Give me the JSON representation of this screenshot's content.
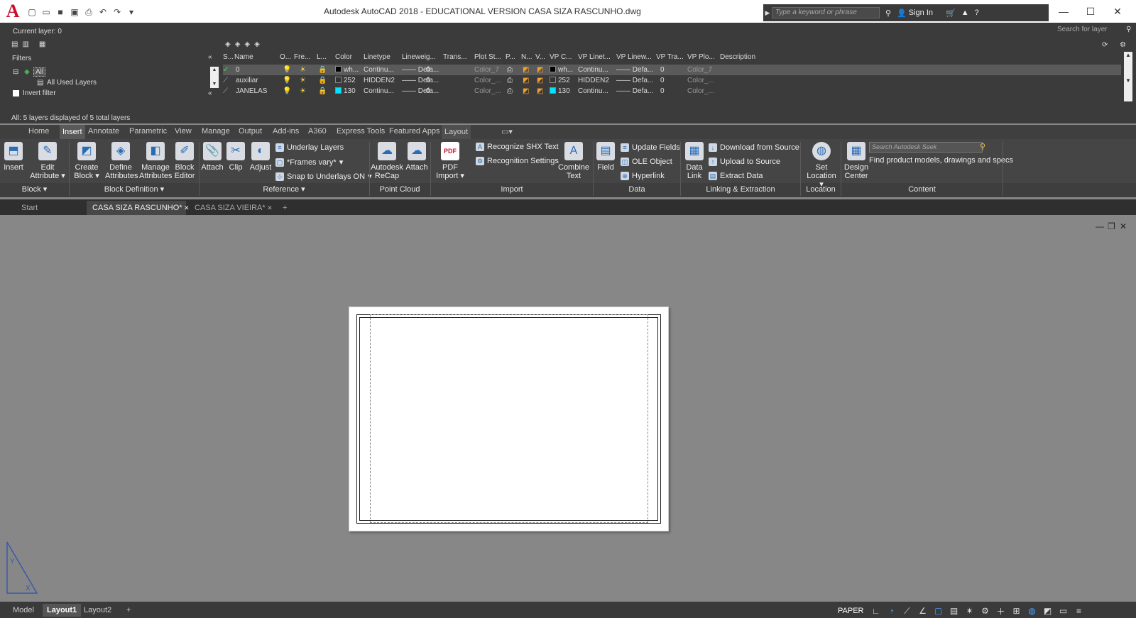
{
  "app": {
    "title": "Autodesk AutoCAD 2018 - EDUCATIONAL VERSION     CASA SIZA RASCUNHO.dwg",
    "logo_letter": "A",
    "search_placeholder": "Type a keyword or phrase",
    "sign_in": "Sign In"
  },
  "layer_panel": {
    "current_layer": "Current layer: 0",
    "search_for_layer": "Search for layer",
    "filters_label": "Filters",
    "tree": [
      "All",
      "All Used Layers"
    ],
    "invert_filter": "Invert filter",
    "status": "All: 5 layers displayed of 5 total layers",
    "columns": [
      "S...",
      "Name",
      "O...",
      "Fre...",
      "L...",
      "Color",
      "Linetype",
      "Lineweig...",
      "Trans...",
      "Plot St...",
      "P...",
      "N...",
      "V...",
      "VP C...",
      "VP Linet...",
      "VP Linew...",
      "VP Tra...",
      "VP Plo...",
      "Description"
    ],
    "rows": [
      {
        "name": "0",
        "color_label": "wh...",
        "color_hex": "#000000",
        "linetype": "Continu...",
        "lineweight": "Defa...",
        "trans": "0",
        "plot_style": "Color_7",
        "vp_color_label": "wh...",
        "vp_color_hex": "#000000",
        "vp_linetype": "Continu...",
        "vp_lineweight": "Defa...",
        "vp_trans": "0",
        "vp_plot": "Color_7"
      },
      {
        "name": "auxiliar",
        "color_label": "252",
        "color_hex": "#333333",
        "linetype": "HIDDEN2",
        "lineweight": "Defa...",
        "trans": "0",
        "plot_style": "Color_...",
        "vp_color_label": "252",
        "vp_color_hex": "#333333",
        "vp_linetype": "HIDDEN2",
        "vp_lineweight": "Defa...",
        "vp_trans": "0",
        "vp_plot": "Color_..."
      },
      {
        "name": "JANELAS",
        "color_label": "130",
        "color_hex": "#00e5ff",
        "linetype": "Continu...",
        "lineweight": "Defa...",
        "trans": "0",
        "plot_style": "Color_...",
        "vp_color_label": "130",
        "vp_color_hex": "#00e5ff",
        "vp_linetype": "Continu...",
        "vp_lineweight": "Defa...",
        "vp_trans": "0",
        "vp_plot": "Color_..."
      }
    ]
  },
  "ribbon": {
    "tabs": [
      "Home",
      "Insert",
      "Annotate",
      "Parametric",
      "View",
      "Manage",
      "Output",
      "Add-ins",
      "A360",
      "Express Tools",
      "Featured Apps",
      "Layout"
    ],
    "active_tab": "Insert",
    "block": {
      "insert": "Insert",
      "edit_attribute": [
        "Edit",
        "Attribute"
      ],
      "footer": "Block"
    },
    "block_definition": {
      "create_block": [
        "Create",
        "Block"
      ],
      "define_attributes": [
        "Define",
        "Attributes"
      ],
      "manage_attributes": [
        "Manage",
        "Attributes"
      ],
      "block_editor": [
        "Block",
        "Editor"
      ],
      "footer": "Block Definition"
    },
    "reference": {
      "attach": "Attach",
      "clip": "Clip",
      "adjust": "Adjust",
      "underlay_layers": "Underlay Layers",
      "frames_vary": "*Frames vary*",
      "snap_to_underlays": "Snap to Underlays ON",
      "footer": "Reference"
    },
    "point_cloud": {
      "recap": [
        "Autodesk",
        "ReCap"
      ],
      "attach": "Attach",
      "footer": "Point Cloud"
    },
    "import": {
      "pdf_import": [
        "PDF",
        "Import"
      ],
      "recognize_shx": "Recognize SHX Text",
      "recognition_settings": "Recognition Settings",
      "combine_text": [
        "Combine",
        "Text"
      ],
      "footer": "Import"
    },
    "data": {
      "field": "Field",
      "update_fields": "Update Fields",
      "ole_object": "OLE Object",
      "hyperlink": "Hyperlink",
      "footer": "Data"
    },
    "linking": {
      "data_link": [
        "Data",
        "Link"
      ],
      "download": "Download from Source",
      "upload": "Upload to Source",
      "extract": "Extract  Data",
      "footer": "Linking & Extraction"
    },
    "location": {
      "set_location": [
        "Set",
        "Location"
      ],
      "footer": "Location"
    },
    "content": {
      "design_center": [
        "Design",
        "Center"
      ],
      "seek_placeholder": "Search Autodesk Seek",
      "seek_text": "Find product models, drawings and specs",
      "footer": "Content"
    }
  },
  "doc_tabs": [
    "Start",
    "CASA SIZA RASCUNHO*",
    "CASA SIZA VIEIRA*"
  ],
  "active_doc": "CASA SIZA RASCUNHO*",
  "layout_tabs": [
    "Model",
    "Layout1",
    "Layout2"
  ],
  "active_layout": "Layout1",
  "status": {
    "paper": "PAPER"
  }
}
